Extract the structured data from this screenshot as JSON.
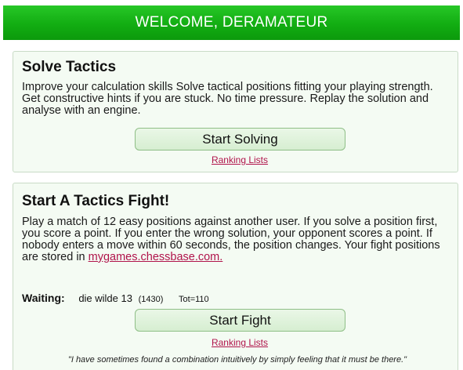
{
  "header": {
    "title": "WELCOME, DERAMATEUR",
    "color": "#12ad12"
  },
  "solve_tactics": {
    "title": "Solve Tactics",
    "description": "Improve your calculation skills Solve tactical positions fitting your playing strength. Get constructive hints if you are stuck. No time pressure. Replay the solution and analyse with an engine.",
    "button_label": "Start Solving",
    "ranking_link": "Ranking Lists"
  },
  "tactics_fight": {
    "title": "Start A Tactics Fight!",
    "description": "Play a match of 12 easy positions against another user. If you solve a position first, you score a point. If you enter the wrong solution, your opponent scores a point. If nobody enters a move within 60 seconds, the position changes. Your fight positions are stored in",
    "link_text": "mygames.chessbase.com.",
    "waiting_label": "Waiting:",
    "waiting_user": "die wilde 13",
    "waiting_rating": "(1430)",
    "waiting_tot": "Tot=110",
    "button_label": "Start Fight",
    "ranking_link": "Ranking Lists",
    "quote": "\"I have sometimes found a combination intuitively by simply feeling that it must be there.\""
  },
  "colors": {
    "panel_background": "#f4fbf3",
    "link": "#b0134a"
  }
}
